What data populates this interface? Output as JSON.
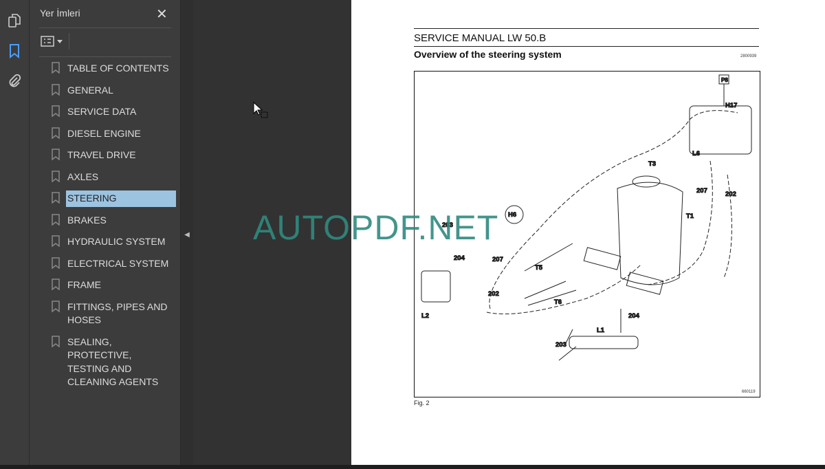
{
  "rail": {
    "icons": [
      "pages-icon",
      "bookmark-icon",
      "attachment-icon"
    ]
  },
  "panel": {
    "title": "Yer İmleri",
    "close": "✕",
    "items": [
      {
        "label": "TABLE OF CONTENTS"
      },
      {
        "label": "GENERAL"
      },
      {
        "label": "SERVICE DATA"
      },
      {
        "label": "DIESEL ENGINE"
      },
      {
        "label": "TRAVEL DRIVE"
      },
      {
        "label": "AXLES"
      },
      {
        "label": "STEERING",
        "selected": true
      },
      {
        "label": "BRAKES"
      },
      {
        "label": "HYDRAULIC SYSTEM"
      },
      {
        "label": "ELECTRICAL SYSTEM"
      },
      {
        "label": "FRAME"
      },
      {
        "label": "FITTINGS, PIPES AND HOSES"
      },
      {
        "label": "SEALING, PROTECTIVE, TESTING AND CLEANING AGENTS"
      }
    ]
  },
  "document": {
    "header": "SERVICE MANUAL LW 50.B",
    "title": "Overview of the steering system",
    "doc_number": "2800939",
    "figure_number": "660119",
    "caption": "Fig. 2",
    "labels": {
      "p": "P8",
      "h17": "H17",
      "l6": "L6",
      "t3": "T3",
      "n207a": "207",
      "n202a": "202",
      "t1": "T1",
      "h6": "H6",
      "n203a": "203",
      "n204a": "204",
      "n207b": "207",
      "t5": "T5",
      "n202b": "202",
      "t6": "T6",
      "l2": "L2",
      "n204b": "204",
      "l1": "L1",
      "n203b": "203"
    }
  },
  "watermark": "AUTOPDF.NET",
  "colors": {
    "selection": "#9cc3e0",
    "accent": "#4a9eff",
    "watermark": "#2f8a7f"
  }
}
